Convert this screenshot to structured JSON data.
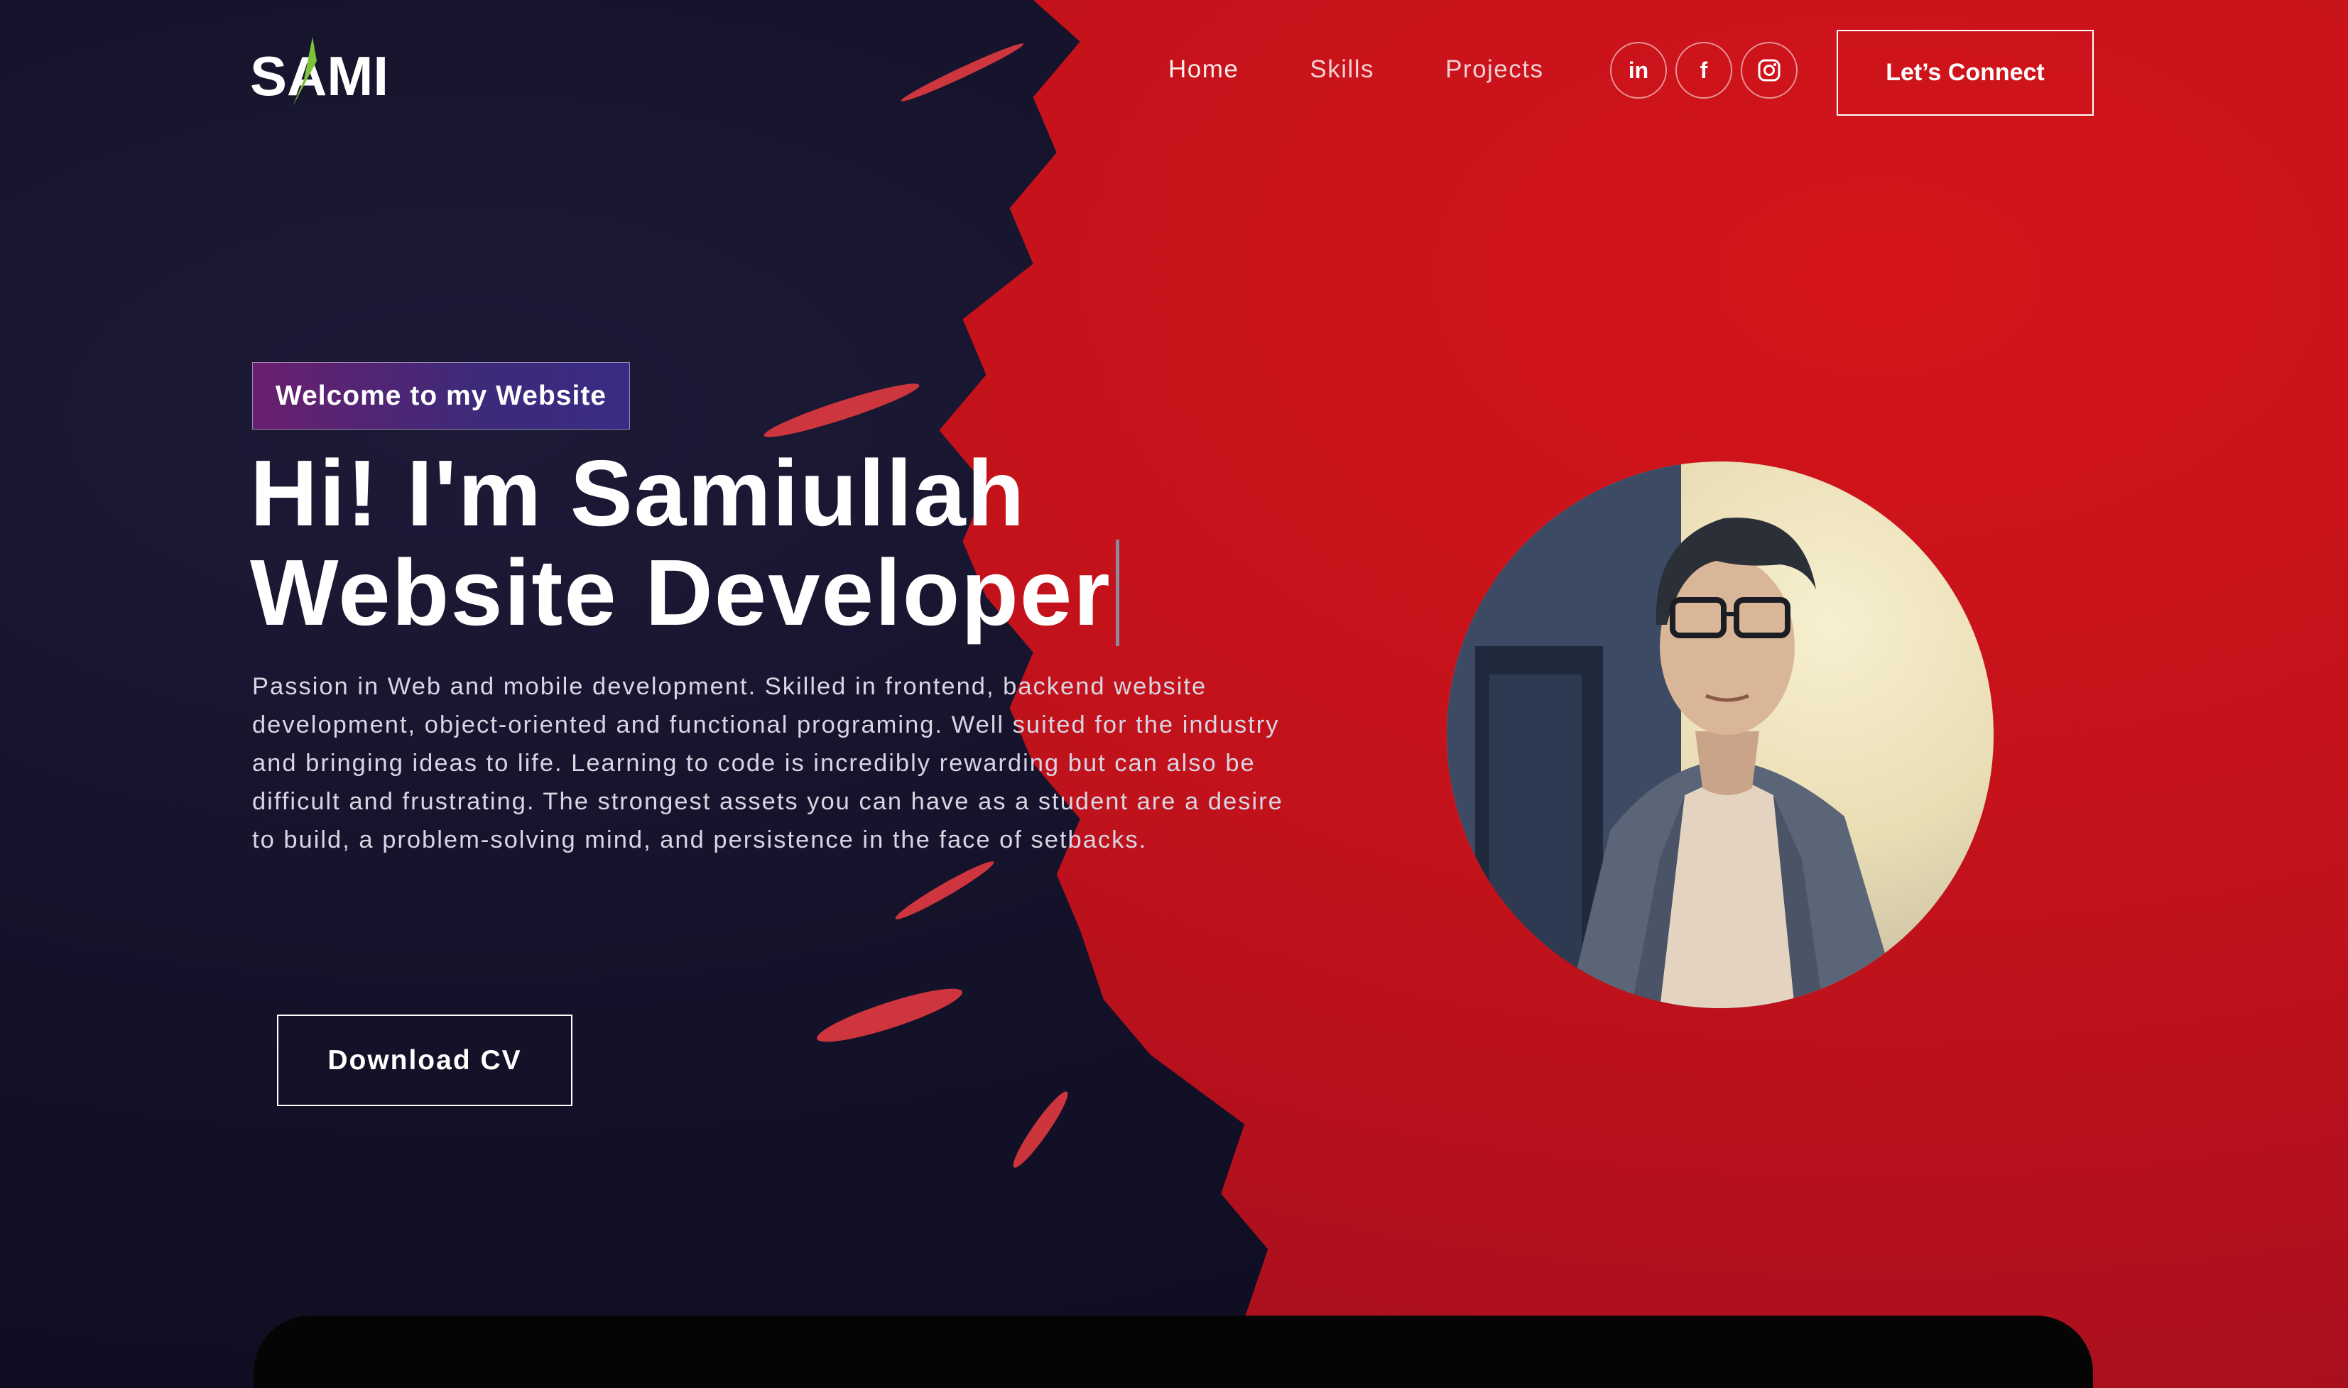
{
  "brand": {
    "logo_text": "SAMI",
    "accent_color": "#7ec23a"
  },
  "nav": {
    "links": [
      "Home",
      "Skills",
      "Projects"
    ],
    "socials": [
      {
        "name": "linkedin",
        "glyph": "in"
      },
      {
        "name": "facebook",
        "glyph": "f"
      },
      {
        "name": "instagram",
        "glyph": "instagram"
      }
    ],
    "connect_label": "Let’s Connect"
  },
  "hero": {
    "tagline": "Welcome to my Website",
    "headline_line1": "Hi! I'm Samiullah",
    "headline_line2": "Website Developer",
    "description": "Passion in Web and mobile development. Skilled in frontend, backend website development, object-oriented and functional programing. Well suited for the industry and bringing ideas to life. Learning to code is incredibly rewarding but can also be difficult and frustrating. The strongest assets you can have as a student are a desire to build, a problem-solving mind, and persistence in the face of setbacks.",
    "cv_label": "Download CV"
  },
  "colors": {
    "dark_bg": "#121026",
    "red_bg": "#c2121b",
    "tagline_gradient_start": "#6a1f6e",
    "tagline_gradient_end": "#3a2b84"
  }
}
